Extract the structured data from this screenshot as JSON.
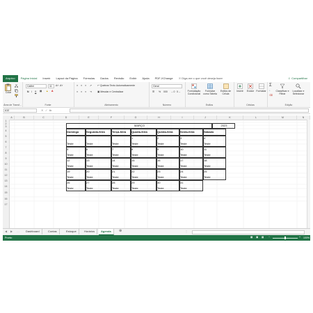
{
  "ribbon_tabs": [
    "Arquivo",
    "Página Inicial",
    "Inserir",
    "Layout da Página",
    "Fórmulas",
    "Dados",
    "Revisão",
    "Exibir",
    "Ajuda",
    "PDF-XChange"
  ],
  "search_hint": "Diga-me o que você deseja fazer",
  "share_label": "Compartilhar",
  "clipboard": {
    "paste_label": "Colar",
    "group": "Área de Transf..."
  },
  "font": {
    "name": "Calibri",
    "size": "11",
    "group": "Fonte"
  },
  "alignment": {
    "wrap_label": "Quebrar Texto Automaticamente",
    "merge_label": "Mesclar e Centralizar",
    "group": "Alinhamento"
  },
  "number": {
    "format": "Geral",
    "group": "Número"
  },
  "styles": {
    "cond_label": "Formatação Condicional",
    "table_label": "Formatar como Tabela",
    "cell_label": "Estilos de Célula",
    "group": "Estilos"
  },
  "cells": {
    "insert_label": "Inserir",
    "delete_label": "Excluir",
    "format_label": "Formatar",
    "group": "Células"
  },
  "editing": {
    "sort_label": "Classificar e Filtrar",
    "find_label": "Localizar e Selecionar",
    "group": "Edição"
  },
  "name_box": "A10",
  "formula_value": "",
  "columns": [
    "A",
    "B",
    "C",
    "D",
    "E",
    "F",
    "G",
    "H",
    "I",
    "J",
    "K",
    "L",
    "M",
    "N"
  ],
  "rows": [
    "1",
    "2",
    "3",
    "4",
    "5",
    "6",
    "7",
    "8",
    "9",
    "10",
    "11",
    "12",
    "13",
    "14",
    "15",
    "16",
    "17"
  ],
  "calendar": {
    "month": "MARÇO",
    "year": "2023",
    "weekdays": [
      "Domingo",
      "Segunda-feira",
      "Terça-feira",
      "Quarta-feira",
      "Quinta-feira",
      "Sexta-feira",
      "Sábado"
    ],
    "event_text": "Teste",
    "weeks": [
      [
        "",
        "",
        "",
        "1",
        "2",
        "3",
        "4"
      ],
      [
        "5",
        "6",
        "7",
        "8",
        "9",
        "10",
        "11"
      ],
      [
        "12",
        "13",
        "14",
        "15",
        "16",
        "17",
        "18"
      ],
      [
        "19",
        "20",
        "21",
        "22",
        "23",
        "24",
        "25"
      ],
      [
        "26",
        "27",
        "28",
        "29",
        "30",
        "31",
        ""
      ]
    ]
  },
  "sheet_tabs": [
    "Dashboard",
    "Contas",
    "Estoque",
    "Horários",
    "Agenda"
  ],
  "active_sheet": "Agenda",
  "status_text": "Pronto",
  "zoom": "100%"
}
